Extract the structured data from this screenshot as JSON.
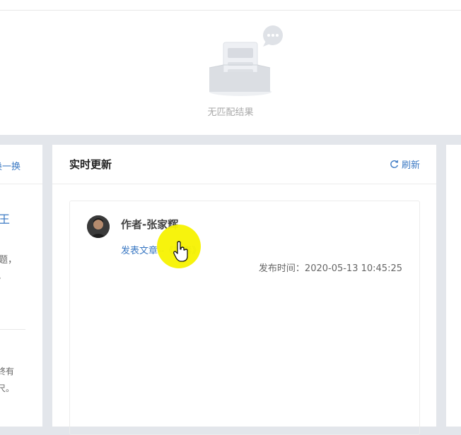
{
  "top_panel": {
    "empty_text": "无匹配结果"
  },
  "left_card": {
    "swap_label": "换一换",
    "title_fragment": "王",
    "line1": "题，",
    "line2": "。",
    "line3": "终有",
    "line4": "尺。"
  },
  "main_card": {
    "title": "实时更新",
    "refresh_label": "刷新",
    "item": {
      "author": "作者-张家辉",
      "article_link": "发表文章--《扫毒》",
      "publish_label": "发布时间：",
      "publish_time": "2020-05-13 10:45:25"
    }
  },
  "colors": {
    "link": "#3a78c3",
    "page_bg": "#e3e6eb",
    "cursor_highlight": "#f7f200"
  },
  "icons": {
    "empty": "empty-inbox-icon",
    "refresh": "refresh-icon",
    "cursor": "hand-pointer-icon"
  }
}
